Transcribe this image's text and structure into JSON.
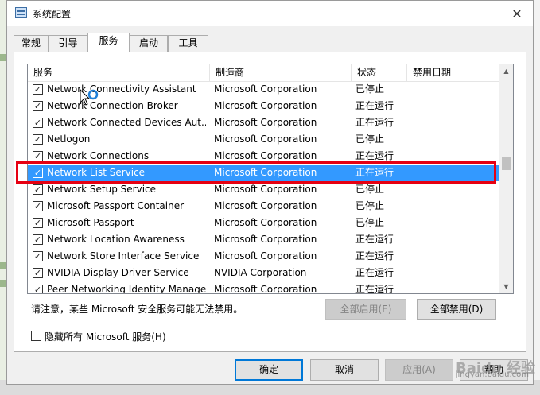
{
  "window": {
    "title": "系统配置",
    "close_symbol": "✕"
  },
  "tabs": [
    {
      "label": "常规"
    },
    {
      "label": "引导"
    },
    {
      "label": "服务"
    },
    {
      "label": "启动"
    },
    {
      "label": "工具"
    }
  ],
  "services": {
    "columns": {
      "name": "服务",
      "vendor": "制造商",
      "status": "状态",
      "disabled_date": "禁用日期"
    },
    "rows": [
      {
        "name": "Network Connectivity Assistant",
        "vendor": "Microsoft Corporation",
        "status": "已停止",
        "checked": true
      },
      {
        "name": "Network Connection Broker",
        "vendor": "Microsoft Corporation",
        "status": "正在运行",
        "checked": true
      },
      {
        "name": "Network Connected Devices Aut...",
        "vendor": "Microsoft Corporation",
        "status": "正在运行",
        "checked": true
      },
      {
        "name": "Netlogon",
        "vendor": "Microsoft Corporation",
        "status": "已停止",
        "checked": true
      },
      {
        "name": "Network Connections",
        "vendor": "Microsoft Corporation",
        "status": "正在运行",
        "checked": true
      },
      {
        "name": "Network List Service",
        "vendor": "Microsoft Corporation",
        "status": "正在运行",
        "checked": true,
        "selected": true
      },
      {
        "name": "Network Setup Service",
        "vendor": "Microsoft Corporation",
        "status": "已停止",
        "checked": true
      },
      {
        "name": "Microsoft Passport Container",
        "vendor": "Microsoft Corporation",
        "status": "已停止",
        "checked": true
      },
      {
        "name": "Microsoft Passport",
        "vendor": "Microsoft Corporation",
        "status": "已停止",
        "checked": true
      },
      {
        "name": "Network Location Awareness",
        "vendor": "Microsoft Corporation",
        "status": "正在运行",
        "checked": true
      },
      {
        "name": "Network Store Interface Service",
        "vendor": "Microsoft Corporation",
        "status": "正在运行",
        "checked": true
      },
      {
        "name": "NVIDIA Display Driver Service",
        "vendor": "NVIDIA Corporation",
        "status": "正在运行",
        "checked": true
      },
      {
        "name": "Peer Networking Identity Manager",
        "vendor": "Microsoft Corporation",
        "status": "正在运行",
        "checked": true
      }
    ]
  },
  "notice": "请注意，某些 Microsoft 安全服务可能无法禁用。",
  "buttons": {
    "enable_all": "全部启用(E)",
    "disable_all": "全部禁用(D)",
    "ok": "确定",
    "cancel": "取消",
    "apply": "应用(A)",
    "help": "帮助"
  },
  "hide_ms_label": "隐藏所有 Microsoft 服务(H)",
  "watermark": {
    "text": "Baidu 经验",
    "url": "jingyan.baidu.com"
  },
  "colors": {
    "selection": "#3399ff",
    "highlight_box": "#e60012",
    "default_button_border": "#0078d7"
  }
}
